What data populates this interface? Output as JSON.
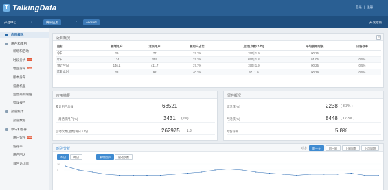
{
  "header": {
    "logo_letter": "T",
    "logo_text": "TalkingData",
    "links": [
      "登录",
      "|",
      "注册"
    ]
  },
  "nav": {
    "home": "产品中心",
    "app": "腾讯应用",
    "platform": "Android",
    "sep": "›",
    "open_platform": "开发指南"
  },
  "sidebar": {
    "items": [
      {
        "label": "应用概况",
        "kind": "group",
        "active": true
      },
      {
        "label": "用户和使用",
        "kind": "group"
      },
      {
        "label": "新增和启动",
        "kind": "sub"
      },
      {
        "label": "时段分析",
        "kind": "sub",
        "badge": "new"
      },
      {
        "label": "地区分布",
        "kind": "sub",
        "badge": "new"
      },
      {
        "label": "版本分布",
        "kind": "sub"
      },
      {
        "label": "设备机型",
        "kind": "sub"
      },
      {
        "label": "运营商和网络",
        "kind": "sub"
      },
      {
        "label": "错误报告",
        "kind": "sub"
      },
      {
        "label": "渠道统计",
        "kind": "group"
      },
      {
        "label": "渠道数据",
        "kind": "sub"
      },
      {
        "label": "参与和留存",
        "kind": "group"
      },
      {
        "label": "用户留存",
        "kind": "sub",
        "badge": "new"
      },
      {
        "label": "留存率",
        "kind": "sub"
      },
      {
        "label": "用户回访",
        "kind": "sub"
      },
      {
        "label": "日回访比率",
        "kind": "sub"
      }
    ]
  },
  "overview": {
    "title": "近日概况",
    "help": "?",
    "columns": [
      "指标",
      "新增用户",
      "活跃用户",
      "新用户占比",
      "启动(次数/人均)",
      "平均使用时长",
      "日留存率"
    ],
    "rows": [
      [
        "今日",
        "29",
        "77",
        "37.7%",
        "150 | 1.9",
        "00:25",
        ""
      ],
      [
        "昨日",
        "134",
        "359",
        "37.3%",
        "650 | 1.8",
        "01:05",
        "0.5%"
      ],
      [
        "预计今日",
        "146.1",
        "411.7",
        "37.7%",
        "150 | 1.9",
        "00:25",
        "0.5%"
      ],
      [
        "昨日此时",
        "28",
        "92",
        "40.2%",
        "97 | 1.0",
        "00:39",
        "0.5%"
      ]
    ]
  },
  "summary": {
    "title": "应用摘要",
    "rows": [
      {
        "label": "累计用户总数",
        "value": "68521",
        "note": ""
      },
      {
        "label": "一周活跃用户(%)",
        "value": "3431",
        "note": "(5%)"
      },
      {
        "label": "启动次数(总数|每日人均)",
        "value": "262975",
        "note": "| 1.3"
      }
    ]
  },
  "retention": {
    "title": "留存概况",
    "rows": [
      {
        "label": "周活跃(%)",
        "value": "2238",
        "note": "( 3.3% )"
      },
      {
        "label": "月活跃(%)",
        "value": "8448",
        "note": "( 12.3% )"
      },
      {
        "label": "月留存率",
        "value": "5.8%",
        "note": ""
      }
    ]
  },
  "trend": {
    "title": "时段分析",
    "compare_label": "对比:",
    "compare_buttons": [
      "前一天",
      "前一周",
      "上周同期",
      "上月同期"
    ],
    "day_tabs": [
      "今日",
      "昨日"
    ],
    "metric_tabs": [
      "新增用户",
      "启动次数"
    ],
    "y_ticks": [
      "10",
      "5"
    ]
  },
  "chart_data": {
    "type": "line",
    "title": "",
    "xlabel": "",
    "ylabel": "",
    "ylim": [
      0,
      12
    ],
    "x": [
      0,
      1,
      2,
      3,
      4,
      5,
      6,
      7,
      8,
      9,
      10,
      11,
      12,
      13,
      14,
      15,
      16,
      17,
      18,
      19,
      20,
      21,
      22,
      23
    ],
    "series": [
      {
        "values": [
          10,
          6,
          4,
          2,
          1,
          1,
          1,
          1,
          2,
          3,
          4,
          6,
          7,
          6,
          4,
          3,
          2,
          1,
          2,
          2,
          2,
          3,
          1,
          1
        ]
      }
    ]
  },
  "colors": {
    "topbar": "#2a5f93",
    "navbar": "#1f4f7f",
    "accent": "#3f8bd1",
    "line": "#2f6eb5",
    "badge": "#e35b3c"
  }
}
